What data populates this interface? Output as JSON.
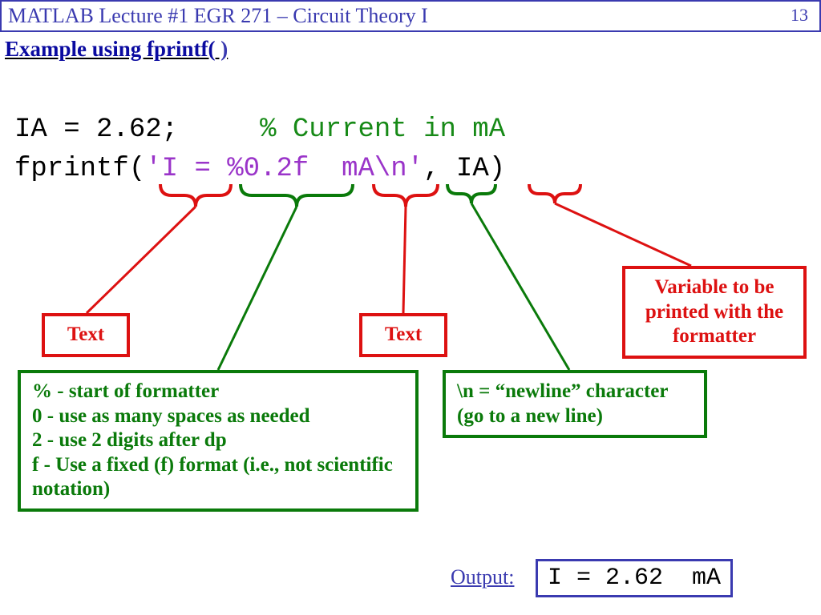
{
  "titlebar": "MATLAB Lecture #1    EGR 271 – Circuit Theory I",
  "page_number": "13",
  "heading_a": "Example using fprintf(",
  "heading_b": " )",
  "code": {
    "line1_a": "IA = 2.62;     ",
    "line1_b": "% Current in mA",
    "line2_a": "fprintf(",
    "line2_b": "'I = %0.2f  mA",
    "line2_c": "\\n",
    "line2_d": "'",
    "line2_e": ", IA)"
  },
  "callouts": {
    "text1": "Text",
    "text2": "Text",
    "variable": "Variable to be printed with the formatter",
    "formatter": "% - start of formatter\n0 - use as many spaces as needed\n2 - use 2 digits after dp\nf - Use a fixed (f) format (i.e., not scientific notation)",
    "newline": "\\n = “newline” character (go to a new line)"
  },
  "output_label": "Output",
  "output_value": "I = 2.62  mA"
}
